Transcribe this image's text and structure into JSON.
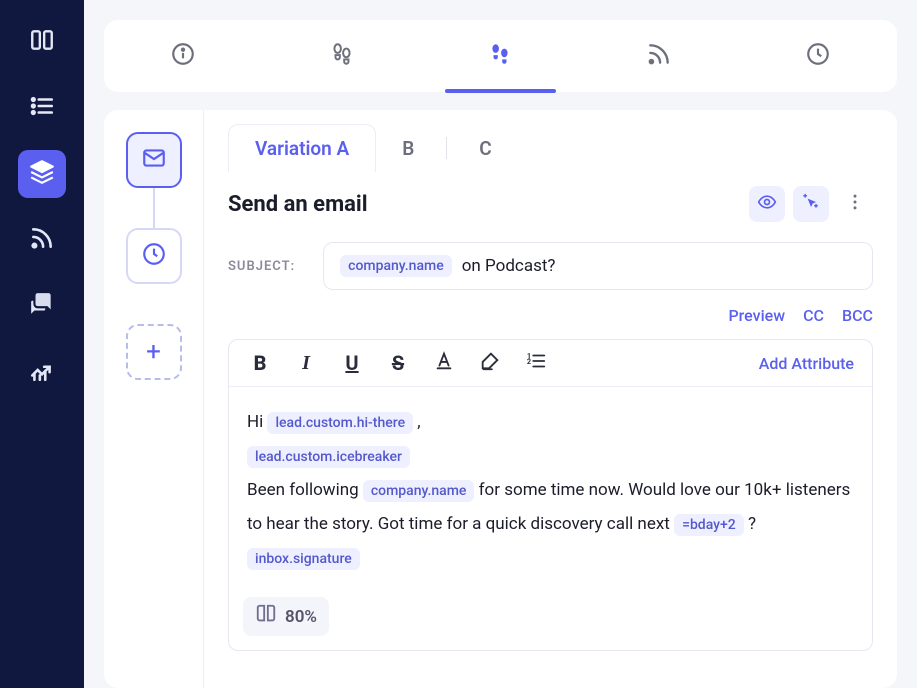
{
  "sidebar": {
    "items": [
      {
        "name": "kanban",
        "active": false
      },
      {
        "name": "list",
        "active": false
      },
      {
        "name": "layers",
        "active": true
      },
      {
        "name": "rss",
        "active": false
      },
      {
        "name": "chat",
        "active": false
      },
      {
        "name": "analytics",
        "active": false
      }
    ]
  },
  "topnav": {
    "items": [
      {
        "name": "info",
        "active": false
      },
      {
        "name": "steps-outline",
        "active": false
      },
      {
        "name": "steps-filled",
        "active": true
      },
      {
        "name": "rss",
        "active": false
      },
      {
        "name": "clock",
        "active": false
      }
    ]
  },
  "steps": [
    {
      "type": "email",
      "active": true
    },
    {
      "type": "wait",
      "active": false
    }
  ],
  "tabs": {
    "items": [
      {
        "label": "Variation A",
        "active": true
      },
      {
        "label": "B",
        "active": false
      },
      {
        "label": "C",
        "active": false
      }
    ]
  },
  "section": {
    "title": "Send an email"
  },
  "subject": {
    "label": "SUBJECT:",
    "chip": "company.name",
    "text": "on Podcast?"
  },
  "links": {
    "preview": "Preview",
    "cc": "CC",
    "bcc": "BCC"
  },
  "toolbar": {
    "add_attribute": "Add Attribute"
  },
  "body": {
    "line1_prefix": "Hi",
    "line1_chip": "lead.custom.hi-there",
    "line1_suffix": ",",
    "line2_chip": "lead.custom.icebreaker",
    "line3_prefix": "Been following",
    "line3_chip": "company.name",
    "line3_mid": "for some time now. Would love our 10k+ listeners to hear the story. Got time for a quick discovery call next",
    "line3_chip2": "=bday+2",
    "line3_suffix": "?",
    "line4_chip": "inbox.signature"
  },
  "footer": {
    "readability": "80%"
  }
}
